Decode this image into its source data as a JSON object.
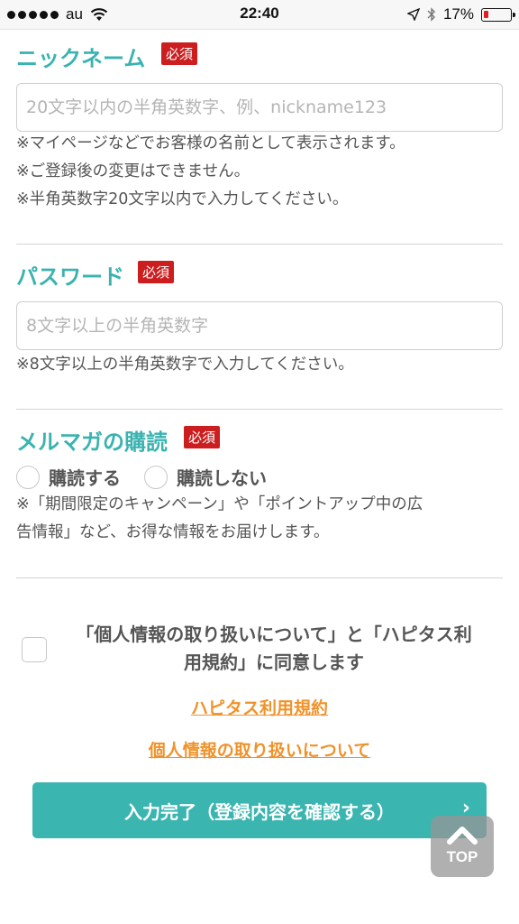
{
  "status_bar": {
    "carrier": "au",
    "time": "22:40",
    "battery": "17%",
    "battery_level": 0.17,
    "icons": [
      "signal-dots-icon",
      "wifi-icon",
      "location-arrow-icon",
      "bluetooth-icon",
      "battery-icon"
    ]
  },
  "nickname": {
    "title": "ニックネーム",
    "required": "必須",
    "placeholder": "20文字以内の半角英数字、例、nickname123",
    "notes": [
      "※マイページなどでお客様の名前として表示されます。",
      "※ご登録後の変更はできません。",
      "※半角英数字20文字以内で入力してください。"
    ]
  },
  "password": {
    "title": "パスワード",
    "required": "必須",
    "placeholder": "8文字以上の半角英数字",
    "note": "※8文字以上の半角英数字で入力してください。"
  },
  "mailmag": {
    "title": "メルマガの購読",
    "required": "必須",
    "options": [
      "購読する",
      "購読しない"
    ],
    "notes": [
      "※「期間限定のキャンペーン」や「ポイントアップ中の広",
      "告情報」など、お得な情報をお届けします。"
    ]
  },
  "agreement": {
    "lines": [
      "「個人情報の取り扱いについて」と「ハピタス利",
      "用規約」に同意します"
    ],
    "link_terms": "ハピタス利用規約",
    "link_privacy": "個人情報の取り扱いについて"
  },
  "submit": {
    "label": "入力完了（登録内容を確認する）",
    "chevron": "›"
  },
  "top_button": {
    "label": "TOP"
  },
  "colors": {
    "accent": "#3ab3b0",
    "required_badge": "#cc1e1e",
    "link": "#f0922a",
    "battery_low": "#e02020"
  }
}
